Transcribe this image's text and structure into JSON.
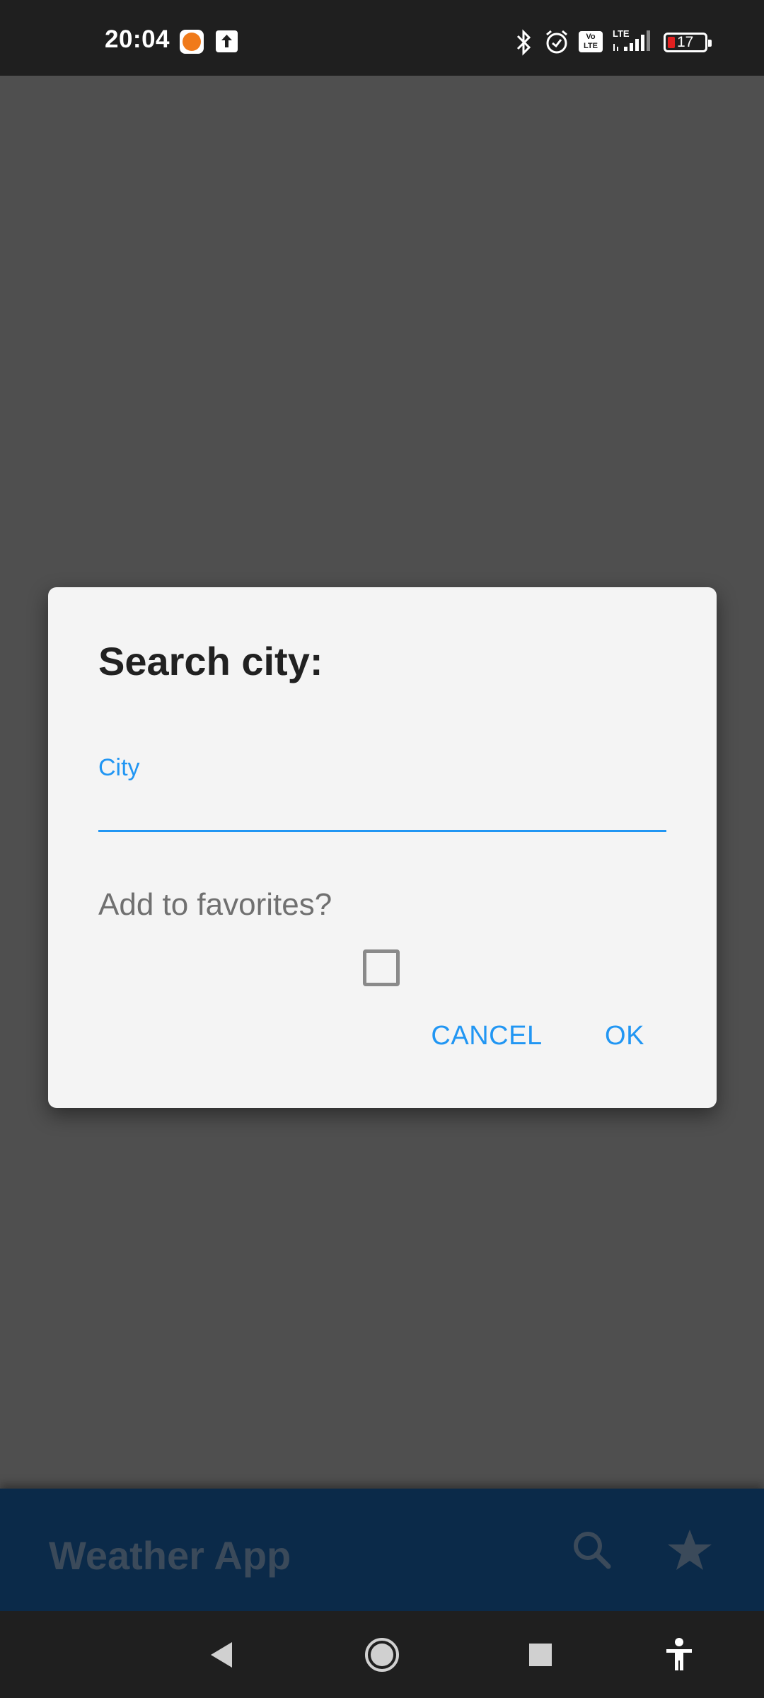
{
  "status_bar": {
    "time": "20:04",
    "lte_label": "LTE",
    "volte_label": "Vo LTE",
    "battery": "17"
  },
  "dialog": {
    "title": "Search city:",
    "city_label": "City",
    "city_value": "",
    "favorites_label": "Add to favorites?",
    "cancel_label": "CANCEL",
    "ok_label": "OK"
  },
  "app_bar": {
    "title": "Weather App"
  },
  "colors": {
    "accent": "#2196f3",
    "app_bar": "#0b2a49",
    "scrim": "#4f4f4f"
  },
  "icons": [
    "bluetooth-icon",
    "alarm-icon",
    "signal-icon",
    "battery-icon",
    "search-icon",
    "star-icon",
    "back-icon",
    "home-icon",
    "recents-icon",
    "accessibility-icon"
  ]
}
